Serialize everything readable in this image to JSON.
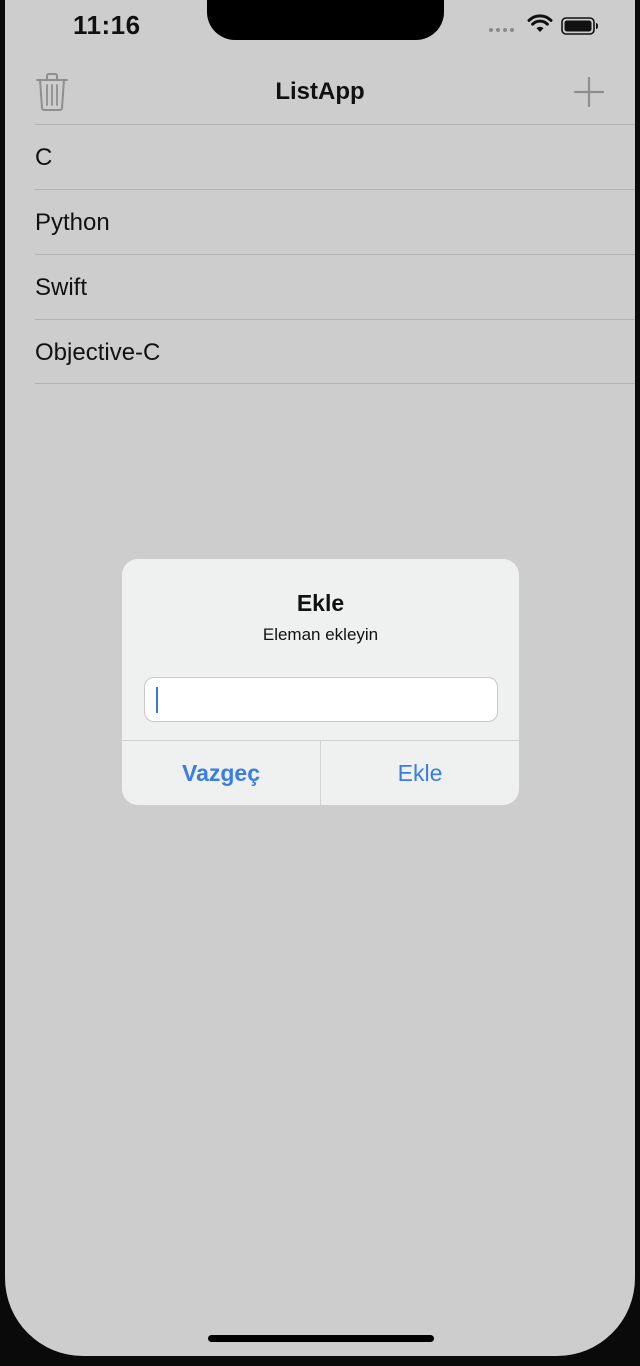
{
  "status_bar": {
    "time": "11:16",
    "signal_icon": "cellular-signal-dots",
    "wifi_icon": "wifi-icon",
    "battery_icon": "battery-icon"
  },
  "navbar": {
    "title": "ListApp",
    "left_icon": "trash-icon",
    "right_icon": "plus-icon"
  },
  "list": {
    "items": [
      {
        "label": "C"
      },
      {
        "label": "Python"
      },
      {
        "label": "Swift"
      },
      {
        "label": "Objective-C"
      }
    ]
  },
  "alert": {
    "title": "Ekle",
    "message": "Eleman ekleyin",
    "input_value": "",
    "input_placeholder": "",
    "cancel_label": "Vazgeç",
    "confirm_label": "Ekle"
  },
  "colors": {
    "background": "#cdcdcd",
    "alert_background": "#eff0f0",
    "accent": "#3a7ee3",
    "separator": "#b3b3b3"
  }
}
